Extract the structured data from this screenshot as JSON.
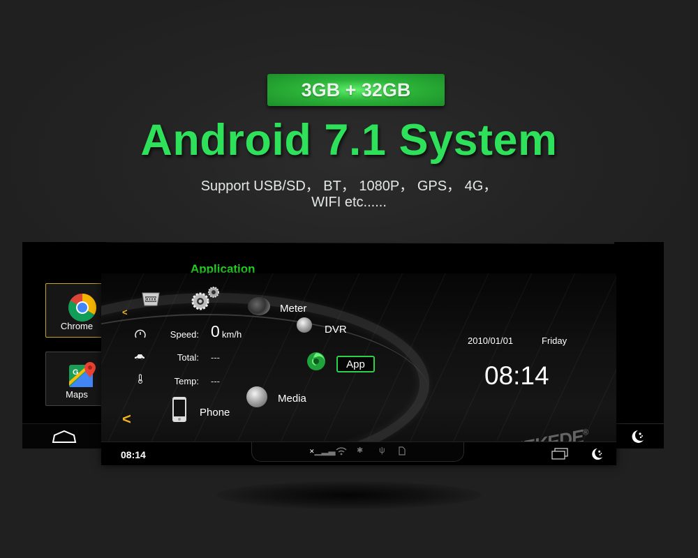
{
  "promo": {
    "badge": "3GB + 32GB",
    "headline": "Android 7.1 System",
    "support_line1": "Support USB/SD， BT，  1080P，  GPS，  4G，",
    "support_line2": "WIFI etc......"
  },
  "back_screen": {
    "heading": "Application",
    "apps": [
      {
        "label": "Chrome",
        "icon": "chrome-icon",
        "selected": true
      },
      {
        "label": "Maps",
        "icon": "google-maps-icon",
        "selected": false
      }
    ],
    "nav": {
      "home_icon": "home-icon",
      "night_icon": "moon-stars-icon"
    }
  },
  "main_screen": {
    "menu": [
      {
        "label": "",
        "icon": "car-grille-icon"
      },
      {
        "label": "",
        "icon": "settings-gears-icon"
      },
      {
        "label": "Meter",
        "icon": "speedometer-icon"
      },
      {
        "label": "DVR",
        "icon": "webcam-icon"
      },
      {
        "label": "App",
        "icon": "app-swirl-icon",
        "selected": true
      },
      {
        "label": "Media",
        "icon": "disc-icon"
      },
      {
        "label": "Phone",
        "icon": "smartphone-icon"
      }
    ],
    "stats": {
      "speed_label": "Speed:",
      "speed_value": "0",
      "speed_unit": "km/h",
      "total_label": "Total:",
      "total_value": "---",
      "temp_label": "Temp:",
      "temp_value": "---"
    },
    "clock": {
      "date": "2010/01/01",
      "day": "Friday",
      "time": "08:14"
    },
    "status_bar": {
      "time": "08:14",
      "icons": [
        "no-signal-icon",
        "wifi-icon",
        "bluetooth-icon",
        "usb-icon",
        "sd-card-icon"
      ],
      "right_icons": [
        "recent-apps-icon",
        "moon-stars-icon"
      ]
    },
    "watermark": "MEKEDE"
  },
  "colors": {
    "accent_green": "#2ee05a",
    "badge_green": "#2bb238",
    "chevron_orange": "#f0b41e",
    "app_border": "#2fd14a"
  }
}
